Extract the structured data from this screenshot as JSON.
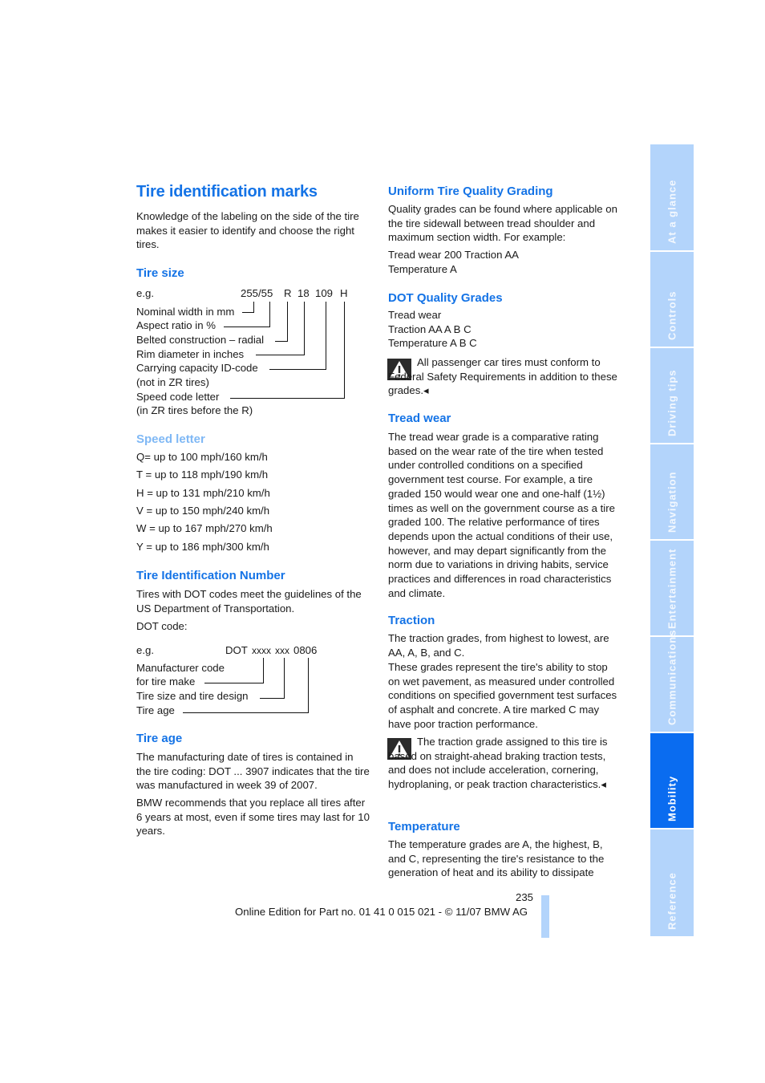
{
  "left": {
    "title": "Tire identification marks",
    "intro": "Knowledge of the labeling on the side of the tire makes it easier to identify and choose the right tires.",
    "tire_size": {
      "heading": "Tire size",
      "eg": "e.g.",
      "codes": [
        "255/55",
        "R",
        "18",
        "109",
        "H"
      ],
      "labels": [
        "Nominal width in mm",
        "Aspect ratio in %",
        "Belted construction – radial",
        "Rim diameter in inches",
        "Carrying capacity ID-code",
        "(not in ZR tires)",
        "Speed code letter",
        "(in ZR tires before the R)"
      ]
    },
    "speed_letter": {
      "heading": "Speed letter",
      "items": [
        "Q= up to 100 mph/160 km/h",
        "T = up to 118 mph/190 km/h",
        "H = up to 131 mph/210 km/h",
        "V = up to 150 mph/240 km/h",
        "W = up to 167 mph/270 km/h",
        "Y = up to 186 mph/300 km/h"
      ]
    },
    "tin": {
      "heading": "Tire Identification Number",
      "text": "Tires with DOT codes meet the guidelines of the US Department of Transportation.",
      "dot_label": "DOT code:",
      "eg": "e.g.",
      "code_prefix": "DOT",
      "code_parts": [
        "xxxx",
        "xxx",
        "0806"
      ],
      "labels": [
        "Manufacturer code",
        "for tire make",
        "Tire size and tire design",
        "Tire age"
      ]
    },
    "tire_age": {
      "heading": "Tire age",
      "p1": "The manufacturing date of tires is contained in the tire coding: DOT ... 3907 indicates that the tire was manufactured in week 39 of 2007.",
      "p2": "BMW recommends that you replace all tires after 6 years at most, even if some tires may last for 10 years."
    }
  },
  "right": {
    "utqg": {
      "heading": "Uniform Tire Quality Grading",
      "text": "Quality grades can be found where applicable on the tire sidewall between tread shoulder and maximum section width. For example:",
      "example_line1": "Tread wear 200 Traction AA",
      "example_line2": "Temperature A"
    },
    "dot_grades": {
      "heading": "DOT Quality Grades",
      "lines": [
        "Tread wear",
        "Traction AA A B C",
        "Temperature A B C"
      ],
      "warning": "All passenger car tires must conform to Federal Safety Requirements in addition to these grades.◂"
    },
    "tread_wear": {
      "heading": "Tread wear",
      "text": "The tread wear grade is a comparative rating based on the wear rate of the tire when tested under controlled conditions on a specified government test course. For example, a tire graded 150 would wear one and one-half (1½) times as well on the government course as a tire graded 100. The relative performance of tires depends upon the actual conditions of their use, however, and may depart significantly from the norm due to variations in driving habits, service practices and differences in road characteristics and climate."
    },
    "traction": {
      "heading": "Traction",
      "p1": "The traction grades, from highest to lowest, are AA, A, B, and C.",
      "p2": "These grades represent the tire's ability to stop on wet pavement, as measured under controlled conditions on specified government test surfaces of asphalt and concrete. A tire marked C may have poor traction performance.",
      "warning": "The traction grade assigned to this tire is based on straight-ahead braking traction tests, and does not include acceleration, cornering, hydroplaning, or peak traction characteristics.◂"
    },
    "temperature": {
      "heading": "Temperature",
      "text": "The temperature grades are A, the highest, B, and C, representing the tire's resistance to the generation of heat and its ability to dissipate"
    }
  },
  "footer": {
    "page_number": "235",
    "edition": "Online Edition for Part no. 01 41 0 015 021 - © 11/07 BMW AG"
  },
  "sidebar": {
    "active_color": "#0a6cf0",
    "inactive_color": "#b3d4fb",
    "tabs": [
      {
        "label": "At a glance",
        "active": false
      },
      {
        "label": "Controls",
        "active": false
      },
      {
        "label": "Driving tips",
        "active": false
      },
      {
        "label": "Navigation",
        "active": false
      },
      {
        "label": "Entertainment",
        "active": false
      },
      {
        "label": "Communications",
        "active": false
      },
      {
        "label": "Mobility",
        "active": true
      },
      {
        "label": "Reference",
        "active": false
      }
    ]
  },
  "icons": {
    "warning": "warning-triangle-icon"
  }
}
